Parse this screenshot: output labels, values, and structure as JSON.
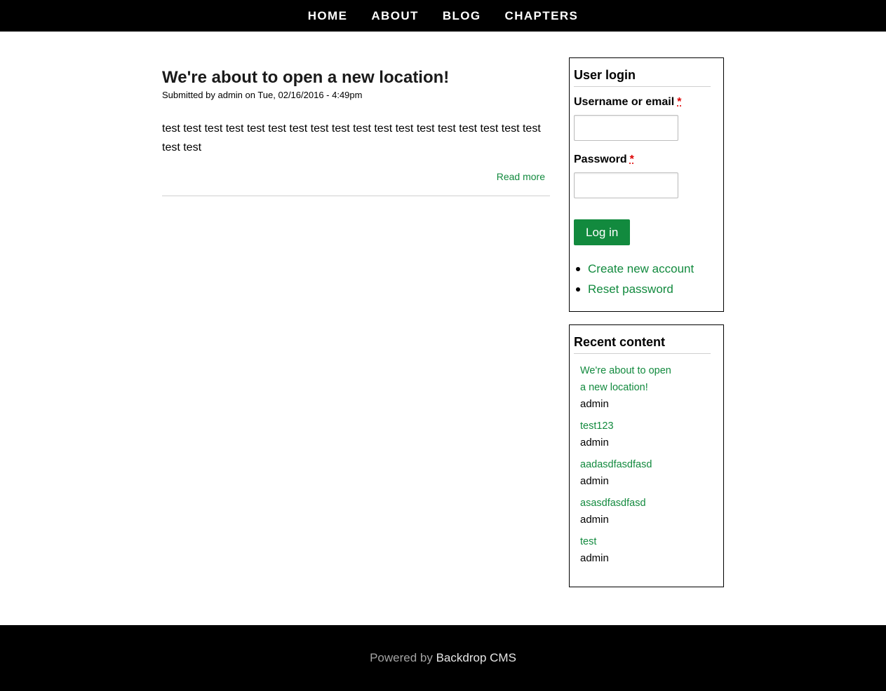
{
  "nav": {
    "items": [
      {
        "label": "HOME"
      },
      {
        "label": "ABOUT"
      },
      {
        "label": "BLOG"
      },
      {
        "label": "CHAPTERS"
      }
    ]
  },
  "article": {
    "title": "We're about to open a new location!",
    "meta": "Submitted by admin on Tue, 02/16/2016 - 4:49pm",
    "body": "test test test test test test test test test test test test test test test test test  test test test",
    "read_more": "Read more"
  },
  "login_block": {
    "title": "User login",
    "username_label": "Username or email",
    "password_label": "Password",
    "required_mark": "*",
    "username_value": "",
    "password_value": "",
    "submit_label": "Log in",
    "links": [
      {
        "label": "Create new account"
      },
      {
        "label": "Reset password"
      }
    ]
  },
  "recent_block": {
    "title": "Recent content",
    "items": [
      {
        "title": "We're about to open a new location!",
        "author": "admin"
      },
      {
        "title": "test123",
        "author": "admin"
      },
      {
        "title": "aadasdfasdfasd",
        "author": "admin"
      },
      {
        "title": "asasdfasdfasd",
        "author": "admin"
      },
      {
        "title": "test",
        "author": "admin"
      }
    ]
  },
  "footer": {
    "prefix": "Powered by",
    "link": "Backdrop CMS"
  },
  "colors": {
    "link_green": "#128a3e",
    "header_bg": "#000000",
    "required_red": "#dd0000"
  }
}
